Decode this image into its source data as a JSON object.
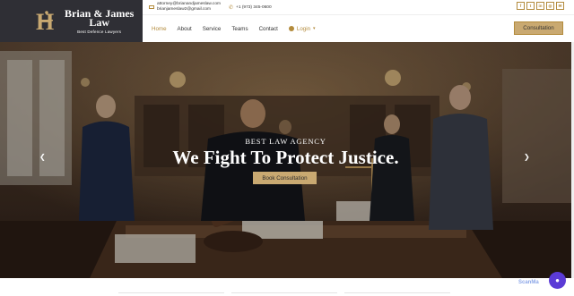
{
  "brand": {
    "title_line1": "Brian & James",
    "title_line2": "Law",
    "subtitle": "Best Defence Lawyers"
  },
  "topbar": {
    "email1": "attorney@brianandjameslaw.com",
    "email2": "brianjameslaw2@gmail.com",
    "phone": "+1 (973) 345-0600",
    "socials": [
      "f",
      "t",
      "in",
      "◎",
      "✉"
    ]
  },
  "nav": {
    "items": [
      "Home",
      "About",
      "Service",
      "Teams",
      "Contact"
    ],
    "login": "Login",
    "consult": "Consultation"
  },
  "hero": {
    "eyebrow": "BEST LAW AGENCY",
    "headline": "We Fight To Protect Justice.",
    "button": "Book Consultation"
  },
  "widget": {
    "scan": "ScanMa"
  },
  "colors": {
    "accent": "#b38b3c",
    "button": "#c9a971",
    "dark": "#2f2f35"
  }
}
